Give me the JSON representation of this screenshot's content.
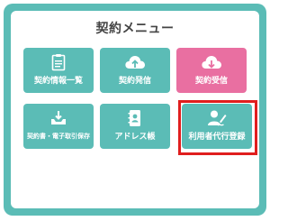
{
  "menu": {
    "title": "契約メニュー",
    "tiles": [
      {
        "label": "契約情報一覧",
        "icon": "document-list-icon",
        "color": "#5bbcb6"
      },
      {
        "label": "契約発信",
        "icon": "cloud-upload-icon",
        "color": "#5bbcb6"
      },
      {
        "label": "契約受信",
        "icon": "cloud-download-icon",
        "color": "#e96fa1"
      },
      {
        "label": "契約書・電子取引保存",
        "icon": "tray-download-icon",
        "color": "#5bbcb6"
      },
      {
        "label": "アドレス帳",
        "icon": "address-book-icon",
        "color": "#5bbcb6"
      },
      {
        "label": "利用者代行登録",
        "icon": "user-signature-icon",
        "color": "#5bbcb6"
      }
    ],
    "highlight_color": "#e01e1e",
    "frame_color": "#5bbcb6"
  }
}
